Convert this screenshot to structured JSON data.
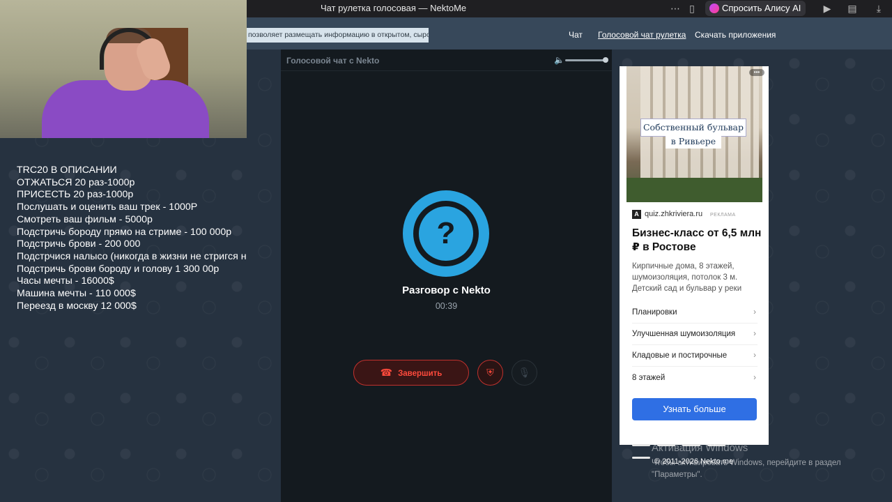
{
  "browser": {
    "tab_title": "Чат рулетка голосовая — NektoMe",
    "alice_label": "Спросить Алису AI",
    "icons": [
      "more-icon",
      "bookmark-icon",
      "alice-icon",
      "video-icon",
      "reader-icon",
      "download-icon"
    ]
  },
  "header": {
    "notice": "позволяет размещать информацию в открытом, сыром виде!",
    "nav": [
      {
        "label": "Чат"
      },
      {
        "label": "Голосовой чат рулетка"
      },
      {
        "label": "Скачать приложения"
      }
    ]
  },
  "overlay": {
    "lines": [
      "TRC20 В ОПИСАНИИ",
      "ОТЖАТЬСЯ 20 раз-1000р",
      "ПРИСЕСТЬ 20 раз-1000р",
      "Послушать и оценить ваш трек - 1000Р",
      "Смотреть ваш фильм - 5000р",
      "Подстричь бороду прямо на стриме - 100 000р",
      "Подстричь брови - 200 000",
      "Подстрчися налысо (никогда в жизни не стригся н",
      "Подстричь брови бороду и голову 1 300 00р",
      "Часы мечты - 16000$",
      "Машина мечты - 110 000$",
      "Переезд в москву 12 000$"
    ]
  },
  "panel": {
    "title": "Голосовой чат с Nekto",
    "question_mark": "?",
    "conversation_title": "Разговор с Nekto",
    "timer": "00:39",
    "end_label": "Завершить",
    "volume_level": 1.0
  },
  "ad": {
    "photo_text_line1": "Собственный бульвар",
    "photo_text_line2": "в Ривьере",
    "source_logo": "A",
    "source": "quiz.zhkriviera.ru",
    "tag": "РЕКЛАМА",
    "headline": "Бизнес-класс от 6,5 млн ₽ в Ростове",
    "description": "Кирпичные дома, 8 этажей, шумоизоляция, потолок 3 м. Детский сад и бульвар у реки",
    "links": [
      {
        "label": "Планировки"
      },
      {
        "label": "Улучшенная шумоизоляция"
      },
      {
        "label": "Кладовые и постирочные"
      },
      {
        "label": "8 этажей"
      }
    ],
    "cta": "Узнать больше"
  },
  "footer": {
    "windows_title": "Активация Windows",
    "windows_text": "Чтобы активировать Windows, перейдите в раздел \"Параметры\".",
    "copyright": "© 2011-2026 Nekto.me"
  }
}
